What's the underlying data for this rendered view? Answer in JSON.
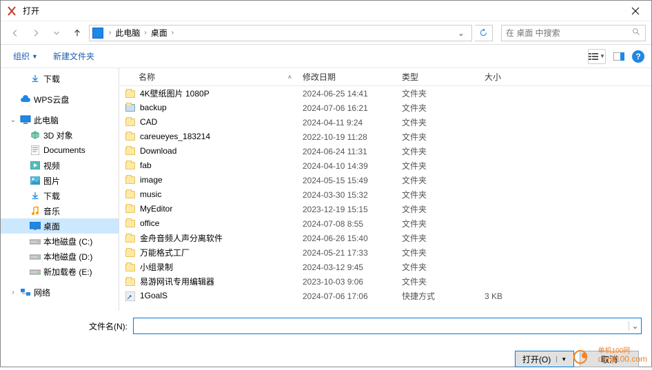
{
  "window": {
    "title": "打开"
  },
  "nav": {
    "breadcrumb": [
      "此电脑",
      "桌面"
    ],
    "search_placeholder": "在 桌面 中搜索"
  },
  "toolbar": {
    "organize": "组织",
    "new_folder": "新建文件夹"
  },
  "sidebar": [
    {
      "label": "下载",
      "icon": "download",
      "depth": 1,
      "exp": ""
    },
    {
      "label": "",
      "spacer": true
    },
    {
      "label": "WPS云盘",
      "icon": "cloud",
      "depth": 0,
      "exp": ""
    },
    {
      "label": "",
      "spacer": true
    },
    {
      "label": "此电脑",
      "icon": "pc",
      "depth": 0,
      "exp": "v"
    },
    {
      "label": "3D 对象",
      "icon": "3d",
      "depth": 1
    },
    {
      "label": "Documents",
      "icon": "docs",
      "depth": 1
    },
    {
      "label": "视频",
      "icon": "video",
      "depth": 1
    },
    {
      "label": "图片",
      "icon": "pics",
      "depth": 1
    },
    {
      "label": "下载",
      "icon": "download",
      "depth": 1
    },
    {
      "label": "音乐",
      "icon": "music",
      "depth": 1
    },
    {
      "label": "桌面",
      "icon": "desktop",
      "depth": 1,
      "sel": true
    },
    {
      "label": "本地磁盘 (C:)",
      "icon": "drive",
      "depth": 1
    },
    {
      "label": "本地磁盘 (D:)",
      "icon": "drive",
      "depth": 1
    },
    {
      "label": "新加载卷 (E:)",
      "icon": "drive",
      "depth": 1
    },
    {
      "label": "",
      "spacer": true
    },
    {
      "label": "网络",
      "icon": "network",
      "depth": 0,
      "exp": ">"
    }
  ],
  "columns": {
    "name": "名称",
    "date": "修改日期",
    "type": "类型",
    "size": "大小"
  },
  "files": [
    {
      "name": "4K壁纸图片 1080P",
      "date": "2024-06-25 14:41",
      "type": "文件夹",
      "size": "",
      "kind": "folder"
    },
    {
      "name": "backup",
      "date": "2024-07-06 16:21",
      "type": "文件夹",
      "size": "",
      "kind": "folder-share"
    },
    {
      "name": "CAD",
      "date": "2024-04-11 9:24",
      "type": "文件夹",
      "size": "",
      "kind": "folder"
    },
    {
      "name": "careueyes_183214",
      "date": "2022-10-19 11:28",
      "type": "文件夹",
      "size": "",
      "kind": "folder"
    },
    {
      "name": "Download",
      "date": "2024-06-24 11:31",
      "type": "文件夹",
      "size": "",
      "kind": "folder"
    },
    {
      "name": "fab",
      "date": "2024-04-10 14:39",
      "type": "文件夹",
      "size": "",
      "kind": "folder"
    },
    {
      "name": "image",
      "date": "2024-05-15 15:49",
      "type": "文件夹",
      "size": "",
      "kind": "folder"
    },
    {
      "name": "music",
      "date": "2024-03-30 15:32",
      "type": "文件夹",
      "size": "",
      "kind": "folder"
    },
    {
      "name": "MyEditor",
      "date": "2023-12-19 15:15",
      "type": "文件夹",
      "size": "",
      "kind": "folder"
    },
    {
      "name": "office",
      "date": "2024-07-08 8:55",
      "type": "文件夹",
      "size": "",
      "kind": "folder"
    },
    {
      "name": "金舟音频人声分离软件",
      "date": "2024-06-26 15:40",
      "type": "文件夹",
      "size": "",
      "kind": "folder"
    },
    {
      "name": "万能格式工厂",
      "date": "2024-05-21 17:33",
      "type": "文件夹",
      "size": "",
      "kind": "folder"
    },
    {
      "name": "小组录制",
      "date": "2024-03-12 9:45",
      "type": "文件夹",
      "size": "",
      "kind": "folder"
    },
    {
      "name": "易游网讯专用编辑器",
      "date": "2023-10-03 9:06",
      "type": "文件夹",
      "size": "",
      "kind": "folder"
    },
    {
      "name": "1GoalS",
      "date": "2024-07-06 17:06",
      "type": "快捷方式",
      "size": "3 KB",
      "kind": "shortcut"
    }
  ],
  "footer": {
    "filename_label": "文件名(N):",
    "open": "打开(O)",
    "cancel": "取消"
  },
  "watermark": "danji100.com"
}
